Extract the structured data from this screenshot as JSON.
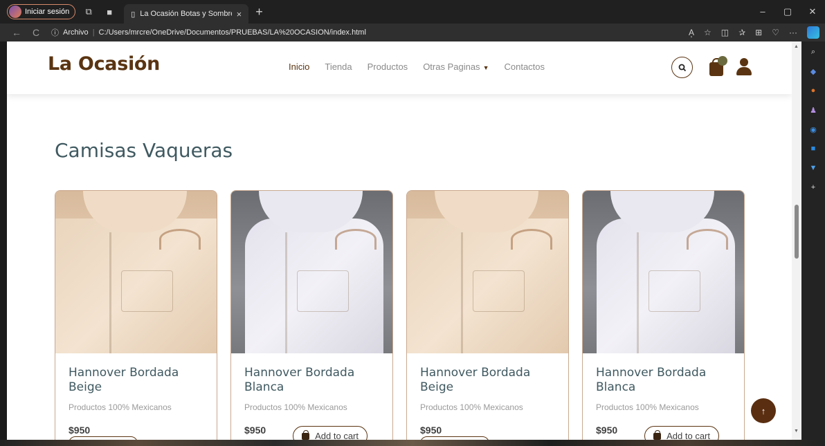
{
  "browser": {
    "profile_label": "Iniciar sesión",
    "tab_title": "La Ocasión Botas y Sombreros",
    "tab_close": "×",
    "new_tab": "+",
    "win_min": "–",
    "win_restore": "▢",
    "win_close": "✕",
    "back": "←",
    "reload": "C",
    "info_icon": "ⓘ",
    "url_prefix": "Archivo",
    "url_sep": "|",
    "url": "C:/Users/mrcre/OneDrive/Documentos/PRUEBAS/LA%20OCASION/index.html",
    "read_aloud": "A͕",
    "more": "···"
  },
  "site": {
    "logo": "La Ocasión",
    "menu": {
      "inicio": "Inicio",
      "tienda": "Tienda",
      "productos": "Productos",
      "otras": "Otras Paginas",
      "contactos": "Contactos"
    }
  },
  "section": {
    "title": "Camisas Vaqueras"
  },
  "products": [
    {
      "name": "Hannover Bordada Beige",
      "desc": "Productos 100% Mexicanos",
      "price": "$950",
      "color": "beige"
    },
    {
      "name": "Hannover Bordada Blanca",
      "desc": "Productos 100% Mexicanos",
      "price": "$950",
      "color": "white",
      "button": "Add to cart"
    },
    {
      "name": "Hannover Bordada Beige",
      "desc": "Productos 100% Mexicanos",
      "price": "$950",
      "color": "beige"
    },
    {
      "name": "Hannover Bordada Blanca",
      "desc": "Productos 100% Mexicanos",
      "price": "$950",
      "color": "white",
      "button": "Add to cart"
    }
  ],
  "colors": {
    "brand": "#5a3412",
    "heading": "#3f5960"
  }
}
